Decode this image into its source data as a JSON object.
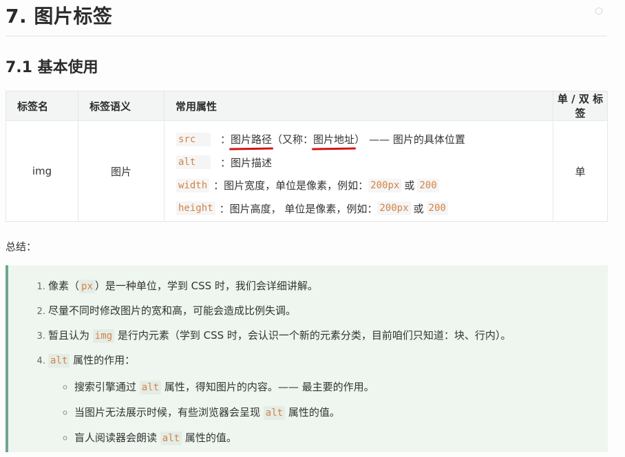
{
  "heading": "7. 图片标签",
  "subheading": "7.1 基本使用",
  "table": {
    "headers": [
      "标签名",
      "标签语义",
      "常用属性",
      "单 / 双 标签"
    ],
    "row": {
      "tag": "img",
      "meaning": "图片",
      "attrs": {
        "src": {
          "name": "src",
          "sep": "：",
          "desc1": "图片路径",
          "paren_open": "（又称：",
          "desc2": "图片地址",
          "paren_close": "）",
          "tail": "—— 图片的具体位置"
        },
        "alt": {
          "name": "alt",
          "sep": "：",
          "desc": "图片描述"
        },
        "width": {
          "name": "width",
          "desc": "：图片宽度，单位是像素，例如：",
          "v1": "200px",
          "or": "或",
          "v2": "200"
        },
        "height": {
          "name": "height",
          "desc": "：图片高度， 单位是像素，例如：",
          "v1": "200px",
          "or": "或",
          "v2": "200"
        }
      },
      "type": "单"
    }
  },
  "summary": {
    "title": "总结：",
    "item1": {
      "a": "像素（",
      "code": "px",
      "b": "）是一种单位，学到 CSS 时，我们会详细讲解。"
    },
    "item2": {
      "text": "尽量不同时修改图片的宽和高，可能会造成比例失调。"
    },
    "item3": {
      "a": "暂且认为 ",
      "code": "img",
      "b": " 是行内元素（学到 CSS 时，会认识一个新的元素分类，目前咱们只知道：块、行内）。"
    },
    "item4": {
      "code": "alt",
      "b": " 属性的作用："
    },
    "sub1": {
      "a": "搜索引擎通过 ",
      "code": "alt",
      "b": " 属性，得知图片的内容。—— 最主要的作用。"
    },
    "sub2": {
      "a": "当图片无法展示时候，有些浏览器会呈现 ",
      "code": "alt",
      "b": " 属性的值。"
    },
    "sub3": {
      "a": "盲人阅读器会朗读 ",
      "code": "alt",
      "b": " 属性的值。"
    }
  },
  "colors": {
    "code": "#d28445",
    "annotation": "#d31515",
    "note_bg": "#eef6ef",
    "note_border": "#6fa58f"
  },
  "icons": {
    "corner": "hexagon-corner-icon"
  }
}
